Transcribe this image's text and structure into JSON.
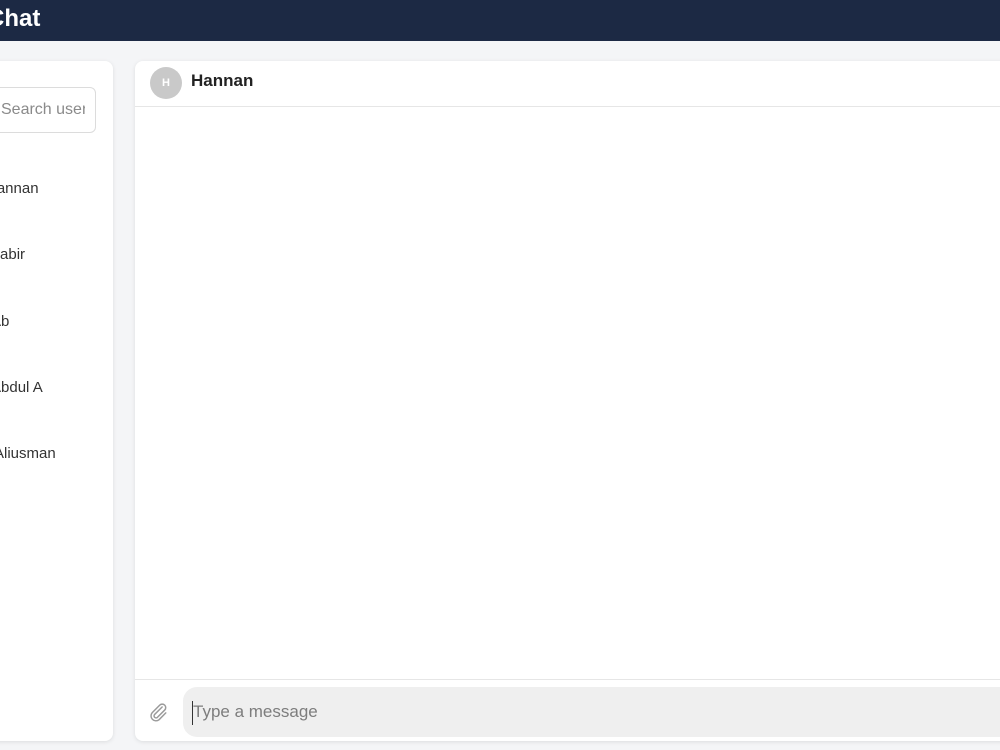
{
  "app": {
    "title": "Chat"
  },
  "sidebar": {
    "search_placeholder": "Search user",
    "contacts": [
      {
        "name": "Hannan"
      },
      {
        "name": "Sabir"
      },
      {
        "name": "Ab"
      },
      {
        "name": "Abdul A"
      },
      {
        "name": "Aliusman"
      }
    ]
  },
  "chat": {
    "avatar_initial": "H",
    "contact_name": "Hannan",
    "input_placeholder": "Type a message",
    "attach_icon": "paperclip-icon"
  }
}
